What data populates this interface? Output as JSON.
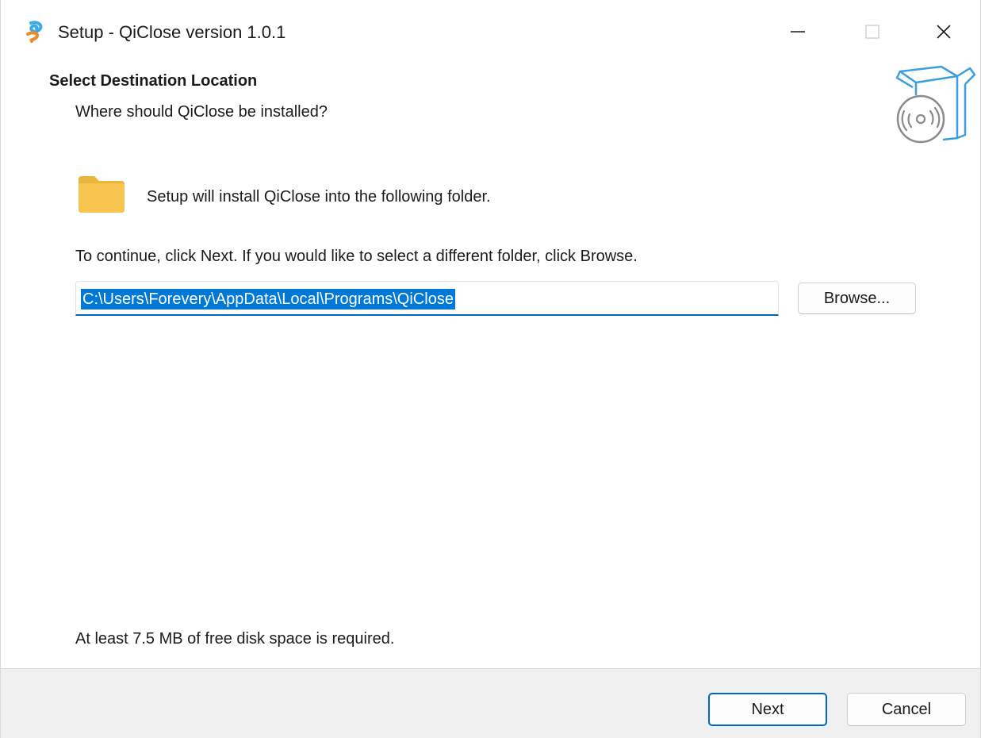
{
  "window": {
    "title": "Setup - QiClose version 1.0.1"
  },
  "icons": {
    "app": "qiclose-app-icon",
    "minimize": "minimize-icon",
    "maximize": "maximize-icon",
    "close": "close-icon",
    "header": "software-box-disc-icon",
    "folder": "folder-icon"
  },
  "header": {
    "title": "Select Destination Location",
    "subtitle": "Where should QiClose be installed?"
  },
  "body": {
    "install_text": "Setup will install QiClose into the following folder.",
    "continue_text": "To continue, click Next. If you would like to select a different folder, click Browse.",
    "path_value": "C:\\Users\\Forevery\\AppData\\Local\\Programs\\QiClose",
    "browse_label": "Browse...",
    "disk_space_text": "At least 7.5 MB of free disk space is required."
  },
  "footer": {
    "next_label": "Next",
    "cancel_label": "Cancel"
  },
  "colors": {
    "accent": "#0067c0",
    "selection": "#0078d7",
    "folder": "#f8c44d",
    "header_graphic": "#3a9ee0"
  }
}
